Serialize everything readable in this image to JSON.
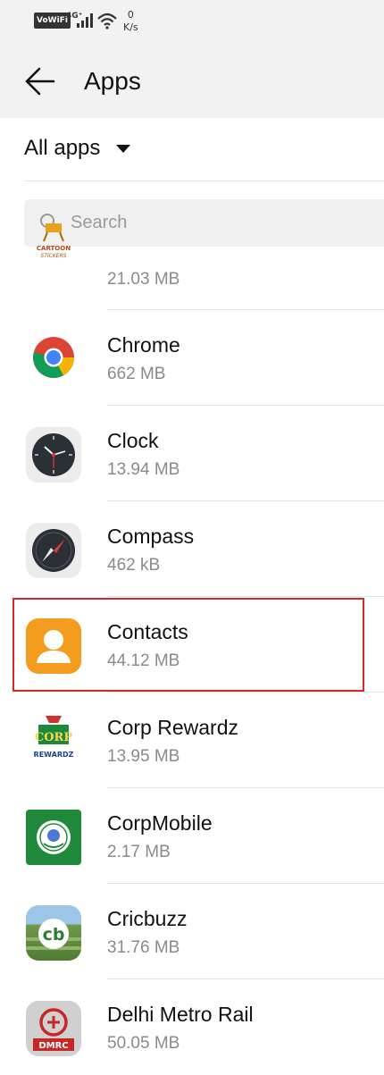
{
  "status_bar": {
    "vowifi": "VoWiFi",
    "network": "4G⁺",
    "speed_value": "0",
    "speed_unit": "K/s"
  },
  "header": {
    "title": "Apps"
  },
  "filter": {
    "label": "All apps"
  },
  "search": {
    "placeholder": "Search"
  },
  "apps": [
    {
      "name": "",
      "size": "21.03 MB",
      "icon": "cartoon-stickers-icon"
    },
    {
      "name": "Chrome",
      "size": "662 MB",
      "icon": "chrome-icon"
    },
    {
      "name": "Clock",
      "size": "13.94 MB",
      "icon": "clock-icon"
    },
    {
      "name": "Compass",
      "size": "462 kB",
      "icon": "compass-icon"
    },
    {
      "name": "Contacts",
      "size": "44.12 MB",
      "icon": "contacts-icon"
    },
    {
      "name": "Corp Rewardz",
      "size": "13.95 MB",
      "icon": "corp-rewardz-icon"
    },
    {
      "name": "CorpMobile",
      "size": "2.17 MB",
      "icon": "corpmobile-icon"
    },
    {
      "name": "Cricbuzz",
      "size": "31.76 MB",
      "icon": "cricbuzz-icon"
    },
    {
      "name": "Delhi Metro Rail",
      "size": "50.05 MB",
      "icon": "dmrc-icon"
    }
  ],
  "icon_text": {
    "cartoon": "CARTOON",
    "stickers": "STICKERS",
    "corp": "CORP",
    "rewardz": "REWARDZ",
    "cricbuzz": "cb",
    "dmrc": "DMRC"
  },
  "colors": {
    "highlight": "#d62828",
    "contacts_orange": "#f39c1e",
    "corpmobile_green": "#1f8a3b"
  }
}
